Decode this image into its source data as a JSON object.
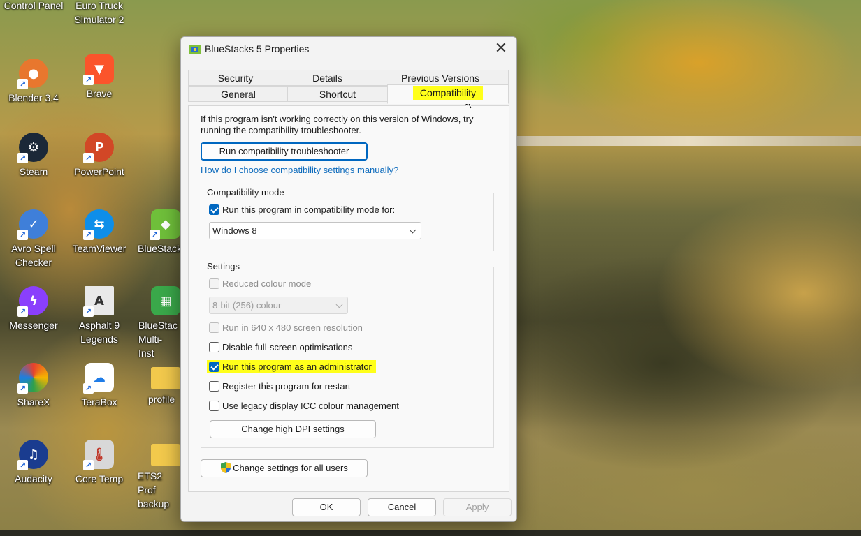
{
  "desktop": {
    "icons": [
      {
        "label": "Control Panel",
        "icon": "control-panel-icon"
      },
      {
        "label": "Euro Truck Simulator 2",
        "icon": "euro-truck-icon"
      },
      {
        "label": "Blender 3.4",
        "icon": "blender-icon"
      },
      {
        "label": "Brave",
        "icon": "brave-icon"
      },
      {
        "label": "Steam",
        "icon": "steam-icon"
      },
      {
        "label": "PowerPoint",
        "icon": "powerpoint-icon"
      },
      {
        "label": "Avro Spell Checker",
        "icon": "avro-icon"
      },
      {
        "label": "TeamViewer",
        "icon": "teamviewer-icon"
      },
      {
        "label": "BlueStack",
        "icon": "bluestacks-icon"
      },
      {
        "label": "Messenger",
        "icon": "messenger-icon"
      },
      {
        "label": "Asphalt 9 Legends",
        "icon": "asphalt-icon"
      },
      {
        "label": "BlueStac Multi-Inst",
        "icon": "bluestacks-multi-icon"
      },
      {
        "label": "ShareX",
        "icon": "sharex-icon"
      },
      {
        "label": "TeraBox",
        "icon": "terabox-icon"
      },
      {
        "label": "profile",
        "icon": "folder-icon"
      },
      {
        "label": "Audacity",
        "icon": "audacity-icon"
      },
      {
        "label": "Core Temp",
        "icon": "core-temp-icon"
      },
      {
        "label": "ETS2 Prof backup",
        "icon": "folder-icon"
      }
    ]
  },
  "dialog": {
    "title": "BlueStacks 5 Properties",
    "tabs_row1": [
      "Security",
      "Details",
      "Previous Versions"
    ],
    "tabs_row2": [
      "General",
      "Shortcut",
      "Compatibility"
    ],
    "active_tab": "Compatibility",
    "intro": "If this program isn't working correctly on this version of Windows, try running the compatibility troubleshooter.",
    "troubleshooter_button": "Run compatibility troubleshooter",
    "help_link": "How do I choose compatibility settings manually?",
    "compat_mode": {
      "group_title": "Compatibility mode",
      "checkbox_label": "Run this program in compatibility mode for:",
      "checked": true,
      "selected_os": "Windows 8"
    },
    "settings": {
      "group_title": "Settings",
      "reduced_colour": {
        "label": "Reduced colour mode",
        "checked": false,
        "enabled": false
      },
      "colour_depth": "8-bit (256) colour",
      "res_640": {
        "label": "Run in 640 x 480 screen resolution",
        "checked": false,
        "enabled": false
      },
      "disable_fullscreen": {
        "label": "Disable full-screen optimisations",
        "checked": false
      },
      "run_admin": {
        "label": "Run this program as an administrator",
        "checked": true
      },
      "register_restart": {
        "label": "Register this program for restart",
        "checked": false
      },
      "legacy_icc": {
        "label": "Use legacy display ICC colour management",
        "checked": false
      },
      "dpi_button": "Change high DPI settings"
    },
    "all_users_button": "Change settings for all users",
    "ok": "OK",
    "cancel": "Cancel",
    "apply": "Apply"
  },
  "colors": {
    "highlight": "#ffff1a",
    "accent": "#0067c0",
    "link": "#0f6cbd"
  }
}
